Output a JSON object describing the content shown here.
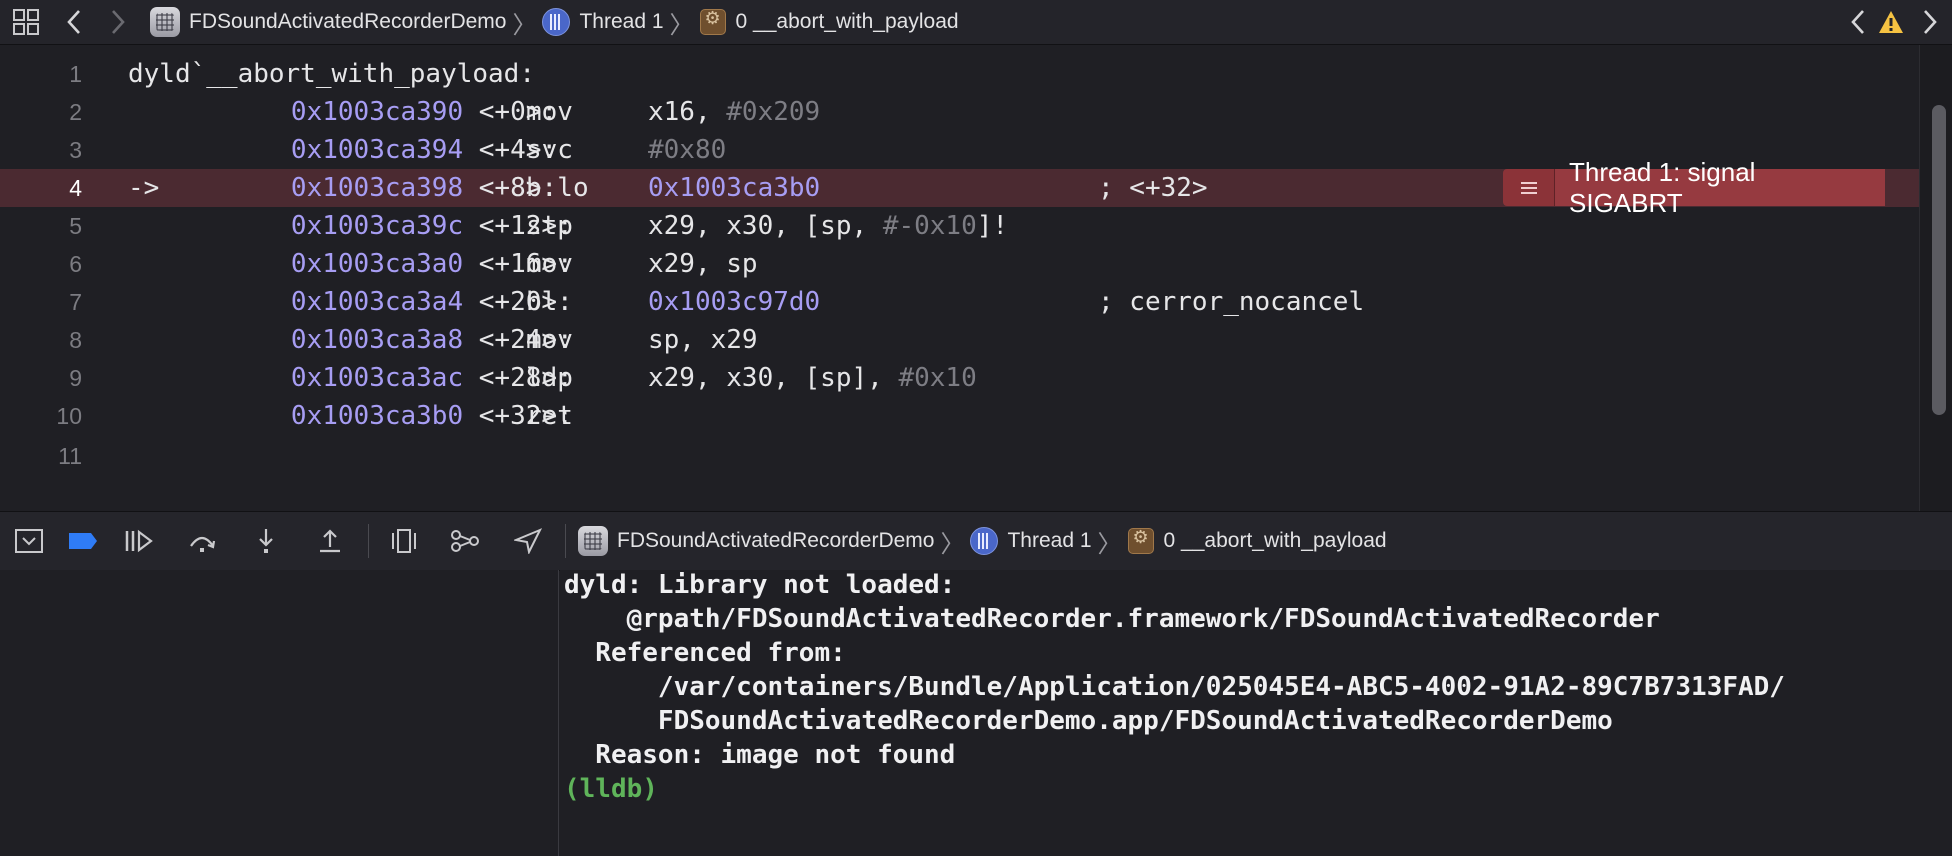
{
  "jumpbar": {
    "crumbs": [
      {
        "label": "FDSoundActivatedRecorderDemo",
        "icon": "project-icon"
      },
      {
        "label": "Thread 1",
        "icon": "thread-icon"
      },
      {
        "label": "0 __abort_with_payload",
        "icon": "stack-frame-icon"
      }
    ],
    "icons": [
      "grid-icon",
      "back-icon",
      "forward-icon",
      "prev-issue-icon",
      "warning-icon",
      "next-issue-icon"
    ],
    "warning_color": "#f5c242"
  },
  "editor": {
    "lines": [
      {
        "num": "1",
        "text": "dyld`__abort_with_payload:"
      },
      {
        "num": "2",
        "addr": "0x1003ca390",
        "off": "<+0>:",
        "op": "mov",
        "args": "x16, ",
        "lit": "#0x209"
      },
      {
        "num": "3",
        "addr": "0x1003ca394",
        "off": "<+4>:",
        "op": "svc",
        "args": "",
        "lit": "#0x80"
      },
      {
        "num": "4",
        "marker": "->",
        "addr": "0x1003ca398",
        "off": "<+8>:",
        "op": "b.lo",
        "target": "0x1003ca3b0",
        "comment": "; <+32>"
      },
      {
        "num": "5",
        "addr": "0x1003ca39c",
        "off": "<+12>:",
        "op": "stp",
        "args": "x29, x30, [sp, ",
        "lit": "#-0x10",
        "tail": "]!"
      },
      {
        "num": "6",
        "addr": "0x1003ca3a0",
        "off": "<+16>:",
        "op": "mov",
        "args": "x29, sp"
      },
      {
        "num": "7",
        "addr": "0x1003ca3a4",
        "off": "<+20>:",
        "op": "bl",
        "target": "0x1003c97d0",
        "comment": "; cerror_nocancel"
      },
      {
        "num": "8",
        "addr": "0x1003ca3a8",
        "off": "<+24>:",
        "op": "mov",
        "args": "sp, x29"
      },
      {
        "num": "9",
        "addr": "0x1003ca3ac",
        "off": "<+28>:",
        "op": "ldp",
        "args": "x29, x30, [sp], ",
        "lit": "#0x10"
      },
      {
        "num": "10",
        "addr": "0x1003ca3b0",
        "off": "<+32>:",
        "op": "ret"
      },
      {
        "num": "11"
      }
    ],
    "current_line": "4",
    "signal": "Thread 1: signal SIGABRT",
    "signal_icon": "list-icon",
    "highlight_color": "#4b2a31"
  },
  "debugbar": {
    "icons": [
      "hide-debug-area-icon",
      "breakpoints-toggle-icon",
      "continue-icon",
      "step-over-icon",
      "step-into-icon",
      "step-out-icon",
      "view-hierarchy-icon",
      "memory-graph-icon",
      "simulate-location-icon"
    ],
    "crumbs": [
      {
        "label": "FDSoundActivatedRecorderDemo",
        "icon": "project-icon"
      },
      {
        "label": "Thread 1",
        "icon": "thread-icon"
      },
      {
        "label": "0 __abort_with_payload",
        "icon": "stack-frame-icon"
      }
    ]
  },
  "console": {
    "lines": [
      "dyld: Library not loaded:",
      "    @rpath/FDSoundActivatedRecorder.framework/FDSoundActivatedRecorder",
      "  Referenced from:",
      "      /var/containers/Bundle/Application/025045E4-ABC5-4002-91A2-89C7B7313FAD/",
      "      FDSoundActivatedRecorderDemo.app/FDSoundActivatedRecorderDemo",
      "  Reason: image not found"
    ],
    "prompt": "(lldb)"
  }
}
